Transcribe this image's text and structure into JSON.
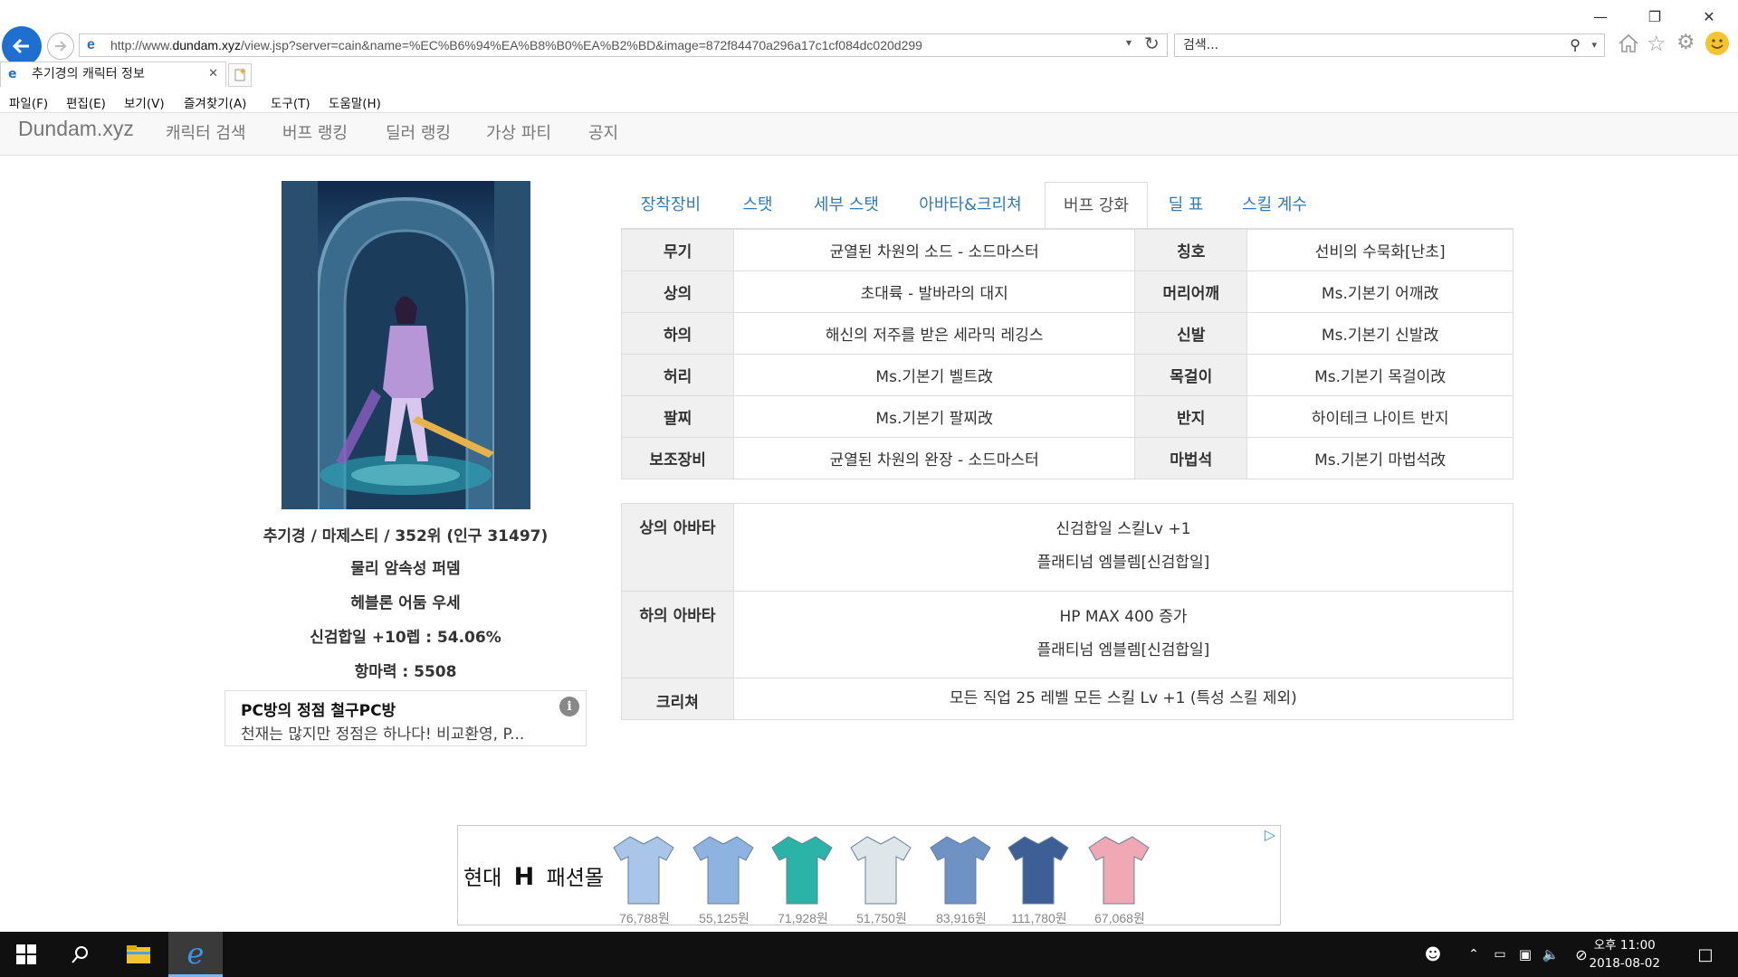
{
  "browser": {
    "url_prefix": "http://www.",
    "url_domain": "dundam.xyz",
    "url_rest": "/view.jsp?server=cain&name=%EC%B6%94%EA%B8%B0%EA%B2%BD&image=872f84470a296a17c1cf084dc020d299",
    "search_placeholder": "검색...",
    "tab_title": "추기경의 캐릭터 정보",
    "menu": [
      "파일(F)",
      "편집(E)",
      "보기(V)",
      "즐겨찾기(A)",
      "도구(T)",
      "도움말(H)"
    ]
  },
  "site": {
    "brand": "Dundam.xyz",
    "nav": [
      "캐릭터 검색",
      "버프 랭킹",
      "딜러 랭킹",
      "가상 파티",
      "공지"
    ]
  },
  "character": {
    "line1": "추기경 / 마제스티 / 352위 (인구 31497)",
    "line2": "물리 암속성 퍼뎀",
    "line3": "헤블론 어둠 우세",
    "line4": "신검합일 +10렙 : 54.06%",
    "line5": "항마력 : 5508"
  },
  "side_ad": {
    "title": "PC방의 정점 철구PC방",
    "text": "천재는 많지만 정점은 하나다! 비교환영, P..."
  },
  "tabs": [
    "장착장비",
    "스탯",
    "세부 스탯",
    "아바타&크리쳐",
    "버프 강화",
    "딜 표",
    "스킬 계수"
  ],
  "active_tab": "버프 강화",
  "equipment": [
    {
      "slot": "무기",
      "item": "균열된 차원의 소드 - 소드마스터",
      "slot2": "칭호",
      "item2": "선비의 수묵화[난초]"
    },
    {
      "slot": "상의",
      "item": "초대륙 - 발바라의 대지",
      "slot2": "머리어깨",
      "item2": "Ms.기본기 어깨改"
    },
    {
      "slot": "하의",
      "item": "해신의 저주를 받은 세라믹 레깅스",
      "slot2": "신발",
      "item2": "Ms.기본기 신발改"
    },
    {
      "slot": "허리",
      "item": "Ms.기본기 벨트改",
      "slot2": "목걸이",
      "item2": "Ms.기본기 목걸이改"
    },
    {
      "slot": "팔찌",
      "item": "Ms.기본기 팔찌改",
      "slot2": "반지",
      "item2": "하이테크 나이트 반지"
    },
    {
      "slot": "보조장비",
      "item": "균열된 차원의 완장 - 소드마스터",
      "slot2": "마법석",
      "item2": "Ms.기본기 마법석改"
    }
  ],
  "avatar": [
    {
      "label": "상의 아바타",
      "line1": "신검합일 스킬Lv +1",
      "line2": "플래티넘 엠블렘[신검합일]"
    },
    {
      "label": "하의 아바타",
      "line1": "HP MAX 400 증가",
      "line2": "플래티넘 엠블렘[신검합일]"
    },
    {
      "label": "크리쳐",
      "line1": "모든 직업 25 레벨 모든 스킬 Lv +1 (특성 스킬 제외)",
      "line2": ""
    }
  ],
  "bottom_ad": {
    "brand_pre": "현대",
    "brand_mark": "H",
    "brand_post": "패션몰",
    "prices": [
      "76,788원",
      "55,125원",
      "71,928원",
      "51,750원",
      "83,916원",
      "111,780원",
      "67,068원"
    ],
    "colors": [
      "#a9c6e8",
      "#8fb3e0",
      "#2bb3a8",
      "#dfe6ea",
      "#6f92c4",
      "#3e5f96",
      "#f0a8b4"
    ]
  },
  "taskbar": {
    "time": "오후 11:00",
    "date": "2018-08-02"
  }
}
